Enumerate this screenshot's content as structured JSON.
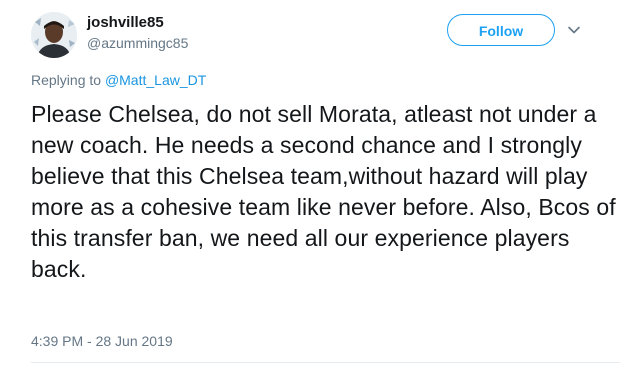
{
  "author": {
    "display_name": "joshville85",
    "handle": "@azummingc85",
    "avatar_icon": "user-avatar-icon"
  },
  "follow_button": {
    "label": "Follow"
  },
  "menu": {
    "icon": "chevron-down-icon"
  },
  "reply": {
    "prefix": "Replying to ",
    "mention": "@Matt_Law_DT"
  },
  "tweet": {
    "text": "Please Chelsea, do not sell Morata, atleast not under a new coach. He needs a second chance and I strongly believe that this Chelsea team,without hazard will play more as a cohesive team like never before. Also, Bcos of this transfer ban, we need all our experience players back.",
    "timestamp": "4:39 PM - 28 Jun 2019"
  },
  "colors": {
    "accent": "#1da1f2",
    "secondary_text": "#657786",
    "primary_text": "#14171a"
  }
}
